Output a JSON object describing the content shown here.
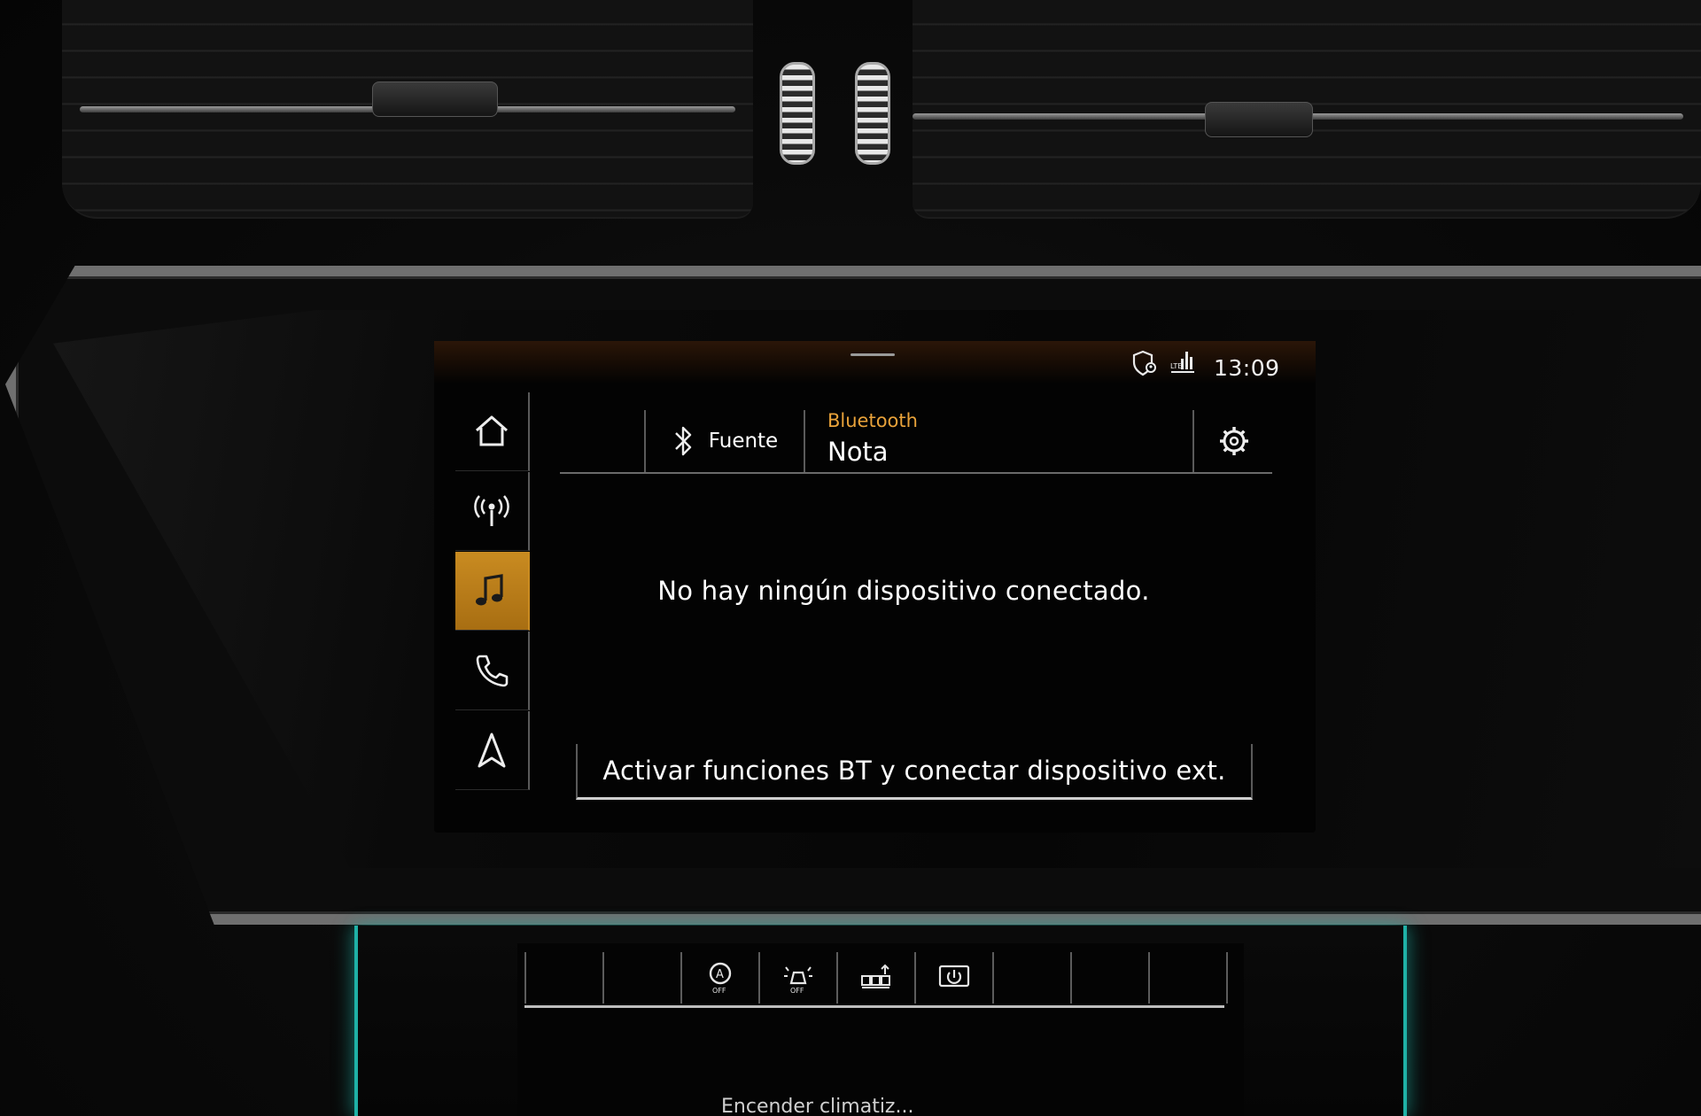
{
  "status_bar": {
    "time": "13:09",
    "icons": [
      "shield-location-icon",
      "lte-signal-icon"
    ]
  },
  "nav": {
    "items": [
      {
        "icon": "home-icon",
        "active": false
      },
      {
        "icon": "radio-icon",
        "active": false
      },
      {
        "icon": "music-icon",
        "active": true
      },
      {
        "icon": "phone-icon",
        "active": false
      },
      {
        "icon": "navigation-icon",
        "active": false
      }
    ],
    "accent": "#c98b21"
  },
  "header": {
    "source_label": "Fuente",
    "source_icon": "bluetooth-icon",
    "kicker": "Bluetooth",
    "title": "Nota",
    "settings_icon": "gear-icon",
    "kicker_color": "#e8a23a"
  },
  "content": {
    "message": "No hay ningún dispositivo conectado.",
    "action_label": "Activar funciones BT y conectar dispositivo ext."
  },
  "lower_panel": {
    "buttons": [
      {
        "icon": "start-stop-off-icon",
        "sub": "OFF"
      },
      {
        "icon": "parking-assist-off-icon",
        "sub": "OFF"
      },
      {
        "icon": "seat-heating-icon"
      },
      {
        "icon": "display-power-icon"
      }
    ],
    "label": "Encender climatiz...",
    "ambient_color": "#1fb1a6"
  }
}
